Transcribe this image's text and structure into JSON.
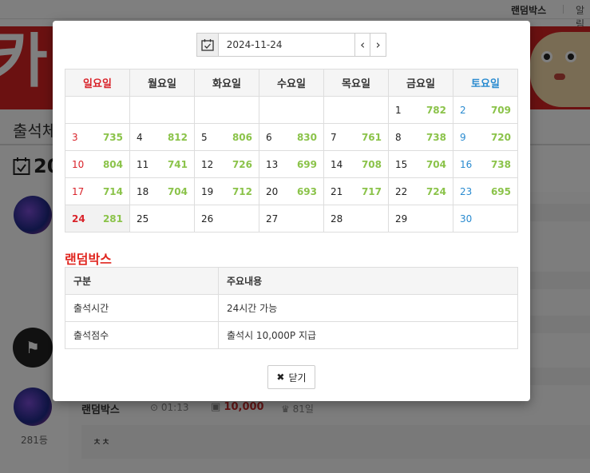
{
  "topbar": {
    "link1": "랜덤박스",
    "link2": "알림"
  },
  "background": {
    "logo_glyph": "카",
    "page_title": "출석체",
    "date_heading": "20",
    "row": {
      "user": "랜덤박스",
      "time": "01:13",
      "point": "10,000",
      "days": "81일",
      "comment": "ㅊㅊ",
      "rank": "281등"
    }
  },
  "datepicker": {
    "value": "2024-11-24",
    "prev": "‹",
    "next": "›"
  },
  "calendar": {
    "headers": [
      "일요일",
      "월요일",
      "화요일",
      "수요일",
      "목요일",
      "금요일",
      "토요일"
    ],
    "weeks": [
      [
        null,
        null,
        null,
        null,
        null,
        {
          "day": "1",
          "count": "782"
        },
        {
          "day": "2",
          "count": "709"
        }
      ],
      [
        {
          "day": "3",
          "count": "735"
        },
        {
          "day": "4",
          "count": "812"
        },
        {
          "day": "5",
          "count": "806"
        },
        {
          "day": "6",
          "count": "830"
        },
        {
          "day": "7",
          "count": "761"
        },
        {
          "day": "8",
          "count": "738"
        },
        {
          "day": "9",
          "count": "720"
        }
      ],
      [
        {
          "day": "10",
          "count": "804"
        },
        {
          "day": "11",
          "count": "741"
        },
        {
          "day": "12",
          "count": "726"
        },
        {
          "day": "13",
          "count": "699"
        },
        {
          "day": "14",
          "count": "708"
        },
        {
          "day": "15",
          "count": "704"
        },
        {
          "day": "16",
          "count": "738"
        }
      ],
      [
        {
          "day": "17",
          "count": "714"
        },
        {
          "day": "18",
          "count": "704"
        },
        {
          "day": "19",
          "count": "712"
        },
        {
          "day": "20",
          "count": "693"
        },
        {
          "day": "21",
          "count": "717"
        },
        {
          "day": "22",
          "count": "724"
        },
        {
          "day": "23",
          "count": "695"
        }
      ],
      [
        {
          "day": "24",
          "count": "281",
          "today": true
        },
        {
          "day": "25",
          "count": ""
        },
        {
          "day": "26",
          "count": ""
        },
        {
          "day": "27",
          "count": ""
        },
        {
          "day": "28",
          "count": ""
        },
        {
          "day": "29",
          "count": ""
        },
        {
          "day": "30",
          "count": ""
        }
      ]
    ]
  },
  "info": {
    "title": "랜덤박스",
    "headers": [
      "구분",
      "주요내용"
    ],
    "rows": [
      {
        "label": "출석시간",
        "value": "24시간 가능"
      },
      {
        "label": "출석점수",
        "value": "출석시 10,000P 지급"
      }
    ]
  },
  "close_label": "닫기",
  "colors": {
    "sunday": "#d9232a",
    "saturday": "#2a8bd0",
    "count": "#8bc34a",
    "accent": "#e0261f",
    "banner": "#d62222"
  }
}
